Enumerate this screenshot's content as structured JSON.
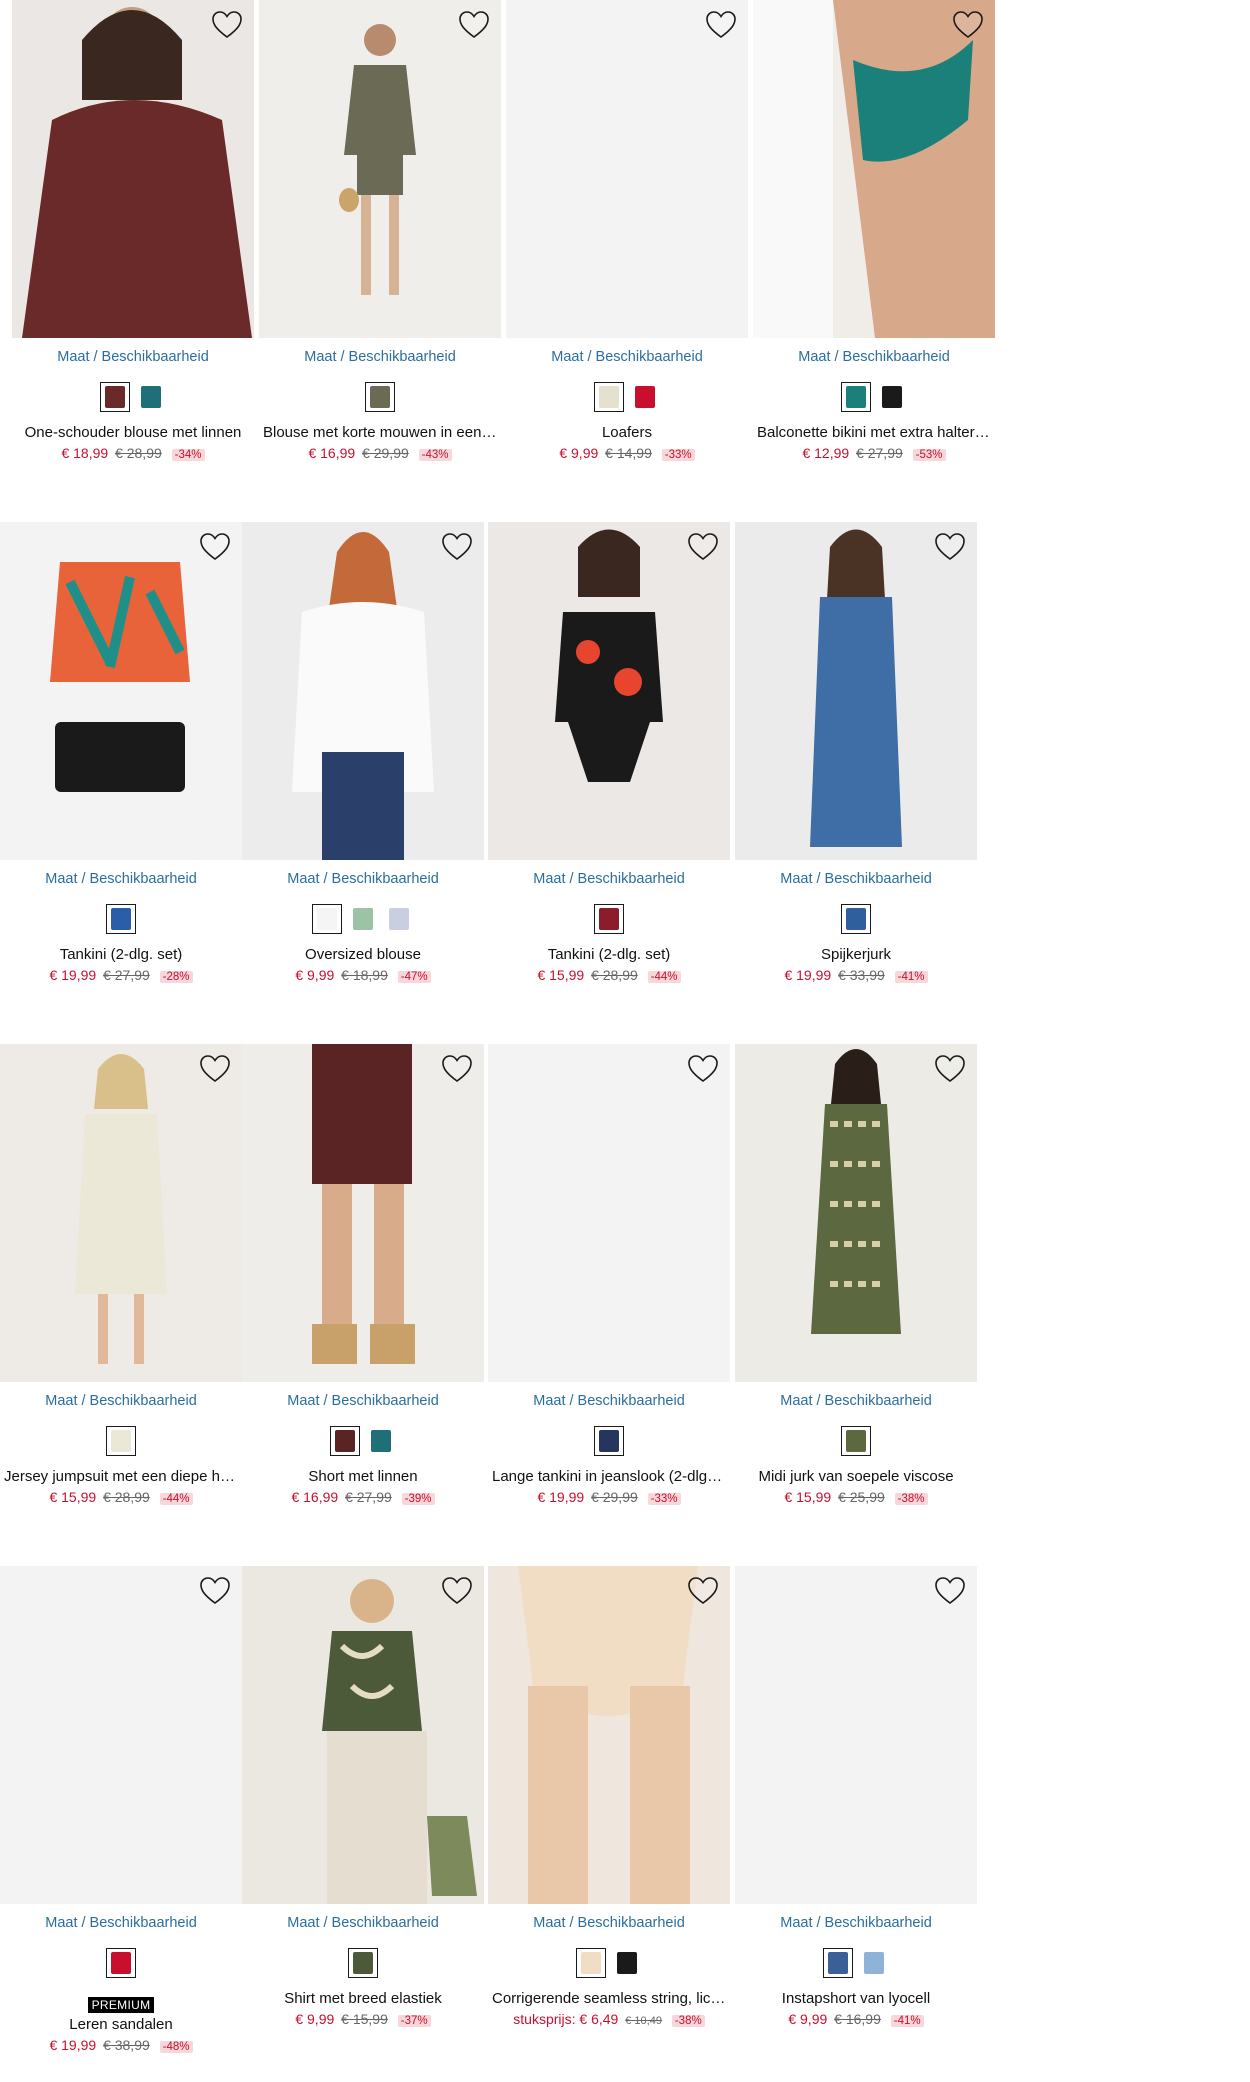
{
  "size_link_label": "Maat / Beschikbaarheid",
  "favorite_icon": "heart-outline-icon",
  "colors": {
    "price": "#c8102e",
    "link": "#2b6e9e",
    "discount_bg": "#f7d7da"
  },
  "products": [
    {
      "name": "One-schouder blouse met linnen",
      "price": "€ 18,99",
      "old_price": "€ 28,99",
      "discount": "-34%",
      "swatches": [
        "#6b2a2a",
        "#1f6f78"
      ]
    },
    {
      "name": "Blouse met korte mouwen in een vi...",
      "price": "€ 16,99",
      "old_price": "€ 29,99",
      "discount": "-43%",
      "swatches": [
        "#6b6a55"
      ]
    },
    {
      "name": "Loafers",
      "price": "€ 9,99",
      "old_price": "€ 14,99",
      "discount": "-33%",
      "swatches": [
        "#e6e0cf",
        "#c8102e"
      ]
    },
    {
      "name": "Balconette bikini met extra halter ...",
      "price": "€ 12,99",
      "old_price": "€ 27,99",
      "discount": "-53%",
      "swatches": [
        "#1b7f7a",
        "#1a1a1a"
      ]
    },
    {
      "name": "Tankini (2-dlg. set)",
      "price": "€ 19,99",
      "old_price": "€ 27,99",
      "discount": "-28%",
      "swatches": [
        "#2b5ea8"
      ]
    },
    {
      "name": "Oversized blouse",
      "price": "€ 9,99",
      "old_price": "€ 18,99",
      "discount": "-47%",
      "swatches": [
        "#f5f5f5",
        "#9cc3a6",
        "#c9cfe0"
      ]
    },
    {
      "name": "Tankini (2-dlg. set)",
      "price": "€ 15,99",
      "old_price": "€ 28,99",
      "discount": "-44%",
      "swatches": [
        "#8a1c2b"
      ]
    },
    {
      "name": "Spijkerjurk",
      "price": "€ 19,99",
      "old_price": "€ 33,99",
      "discount": "-41%",
      "swatches": [
        "#2f5f9c"
      ]
    },
    {
      "name": "Jersey jumpsuit met een diepe hals",
      "price": "€ 15,99",
      "old_price": "€ 28,99",
      "discount": "-44%",
      "swatches": [
        "#ece8d8"
      ]
    },
    {
      "name": "Short met linnen",
      "price": "€ 16,99",
      "old_price": "€ 27,99",
      "discount": "-39%",
      "swatches": [
        "#5a2424",
        "#1f6f78"
      ]
    },
    {
      "name": "Lange tankini in jeanslook (2-dlg. set)",
      "price": "€ 19,99",
      "old_price": "€ 29,99",
      "discount": "-33%",
      "swatches": [
        "#24365e"
      ]
    },
    {
      "name": "Midi jurk van soepele viscose",
      "price": "€ 15,99",
      "old_price": "€ 25,99",
      "discount": "-38%",
      "swatches": [
        "#5b6840"
      ]
    },
    {
      "name": "Leren sandalen",
      "badge": "PREMIUM",
      "price": "€ 19,99",
      "old_price": "€ 38,99",
      "discount": "-48%",
      "swatches": [
        "#c8102e"
      ]
    },
    {
      "name": "Shirt met breed elastiek",
      "price": "€ 9,99",
      "old_price": "€ 15,99",
      "discount": "-37%",
      "swatches": [
        "#4d5a3a"
      ]
    },
    {
      "name": "Corrigerende seamless string, licht ...",
      "unit_label": "stuksprijs:",
      "price": "€ 6,49",
      "old_price": "€ 10,49",
      "discount": "-38%",
      "swatches": [
        "#f1ddc4",
        "#1a1a1a"
      ]
    },
    {
      "name": "Instapshort van lyocell",
      "price": "€ 9,99",
      "old_price": "€ 16,99",
      "discount": "-41%",
      "swatches": [
        "#3b5f97",
        "#8fb3d6"
      ]
    }
  ]
}
